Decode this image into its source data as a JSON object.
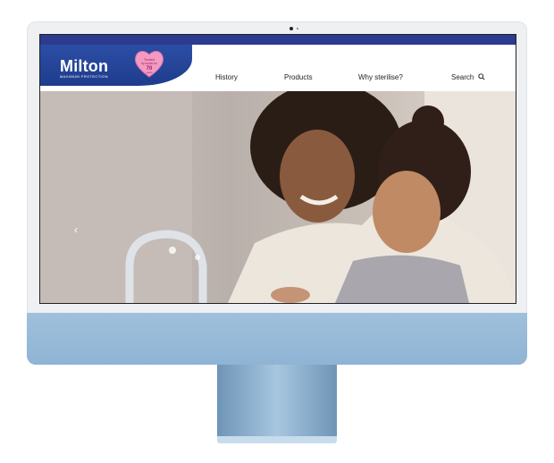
{
  "brand": {
    "name": "Milton",
    "tagline": "MAXIMUM PROTECTION",
    "badge_text": "Trusted by mums for 70 years"
  },
  "nav": {
    "items": [
      "History",
      "Products",
      "Why sterilise?"
    ],
    "search_label": "Search"
  },
  "hero": {
    "prev_icon": "chevron-left-icon"
  },
  "colors": {
    "topbar": "#2c3a8f",
    "brand_blue": "#1f3c8c",
    "badge_pink": "#f39ac3",
    "imac_chin": "#9fc0dc"
  }
}
